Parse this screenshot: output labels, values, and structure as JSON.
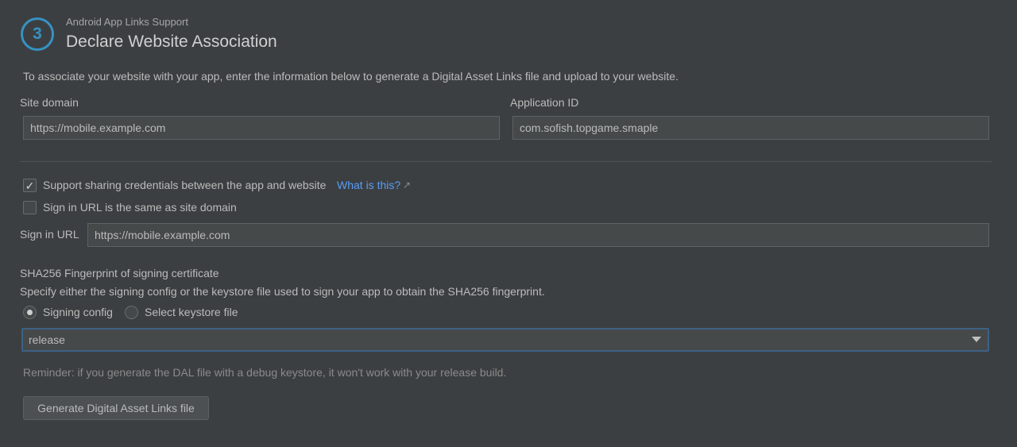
{
  "header": {
    "step_number": "3",
    "subtitle": "Android App Links Support",
    "title": "Declare Website Association"
  },
  "intro_text": "To associate your website with your app, enter the information below to generate a Digital Asset Links file and upload to your website.",
  "site_domain": {
    "label": "Site domain",
    "value": "https://mobile.example.com"
  },
  "application_id": {
    "label": "Application ID",
    "value": "com.sofish.topgame.smaple"
  },
  "credentials": {
    "checked": true,
    "label": "Support sharing credentials between the app and website",
    "link_text": "What is this?",
    "link_icon": "external-link-icon"
  },
  "sign_in_same": {
    "checked": false,
    "label": "Sign in URL is the same as site domain"
  },
  "sign_in_url": {
    "label": "Sign in URL",
    "value": "https://mobile.example.com"
  },
  "fingerprint": {
    "heading": "SHA256 Fingerprint of signing certificate",
    "description": "Specify either the signing config or the keystore file used to sign your app to obtain the SHA256 fingerprint.",
    "options": [
      {
        "label": "Signing config",
        "selected": true
      },
      {
        "label": "Select keystore file",
        "selected": false
      }
    ],
    "selected_config": "release"
  },
  "reminder": "Reminder: if you generate the DAL file with a debug keystore, it won't work with your release build.",
  "generate_button": "Generate Digital Asset Links file",
  "colors": {
    "accent": "#3592c4",
    "link": "#589df6",
    "background": "#3c3f41"
  }
}
